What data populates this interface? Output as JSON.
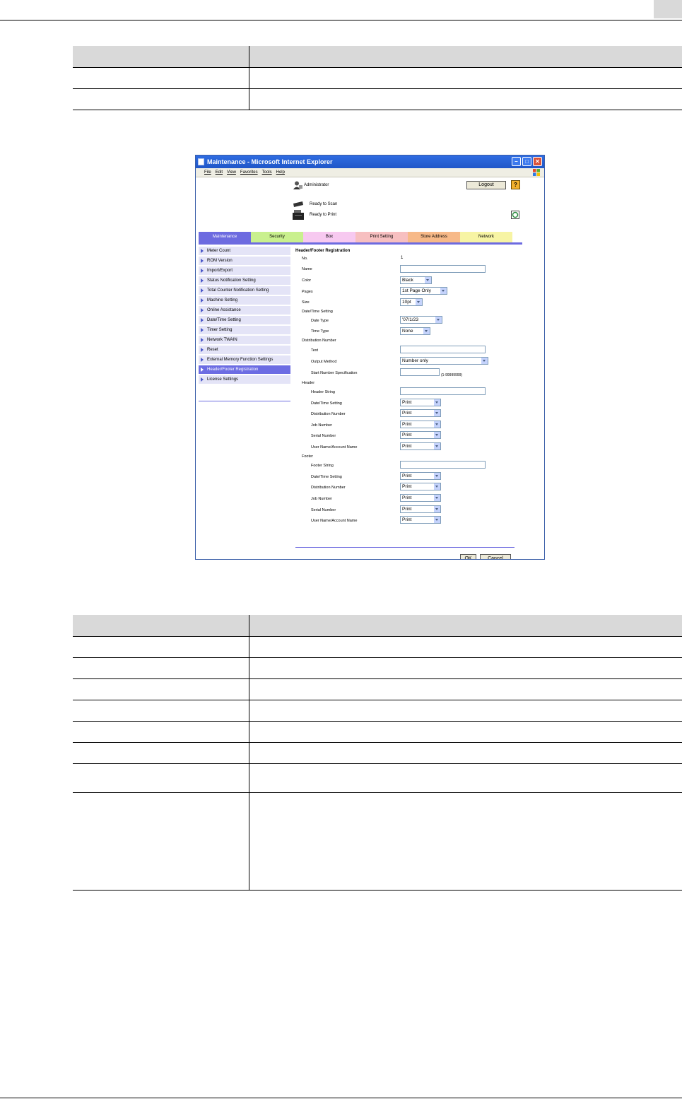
{
  "browser": {
    "title": "Maintenance - Microsoft Internet Explorer",
    "menu": [
      "File",
      "Edit",
      "View",
      "Favorites",
      "Tools",
      "Help"
    ]
  },
  "header": {
    "user": "Administrator",
    "logout_label": "Logout",
    "help_label": "?",
    "scan_status": "Ready to Scan",
    "print_status": "Ready to Print"
  },
  "tabs": [
    {
      "label": "Maintenance",
      "color": "#6d6be0",
      "text_color": "#ffffff"
    },
    {
      "label": "Security",
      "color": "#c9f08e",
      "text_color": "#000000"
    },
    {
      "label": "Box",
      "color": "#f7c9f0",
      "text_color": "#000000"
    },
    {
      "label": "Print Setting",
      "color": "#f7bfc0",
      "text_color": "#000000"
    },
    {
      "label": "Store Address",
      "color": "#f7b988",
      "text_color": "#000000"
    },
    {
      "label": "Network",
      "color": "#f7f4a4",
      "text_color": "#000000"
    }
  ],
  "sidebar": {
    "items": [
      "Meter Count",
      "ROM Version",
      "Import/Export",
      "Status Notification Setting",
      "Total Counter Notification Setting",
      "Machine Setting",
      "Online Assistance",
      "Date/Time Setting",
      "Timer Setting",
      "Network TWAIN",
      "Reset",
      "External Memory Function Settings",
      "Header/Footer Registration",
      "License Settings"
    ],
    "active_index": 12
  },
  "form": {
    "title": "Header/Footer Registration",
    "no_label": "No.",
    "no_value": "1",
    "name_label": "Name",
    "color_label": "Color",
    "color_value": "Black",
    "pages_label": "Pages",
    "pages_value": "1st Page Only",
    "size_label": "Size",
    "size_value": "10pt",
    "datetime_section": "Date/Time Setting",
    "date_type_label": "Date Type",
    "date_type_value": "'07/1/23",
    "time_type_label": "Time Type",
    "time_type_value": "None",
    "distribution_section": "Distribution Number",
    "text_label": "Text",
    "output_method_label": "Output Method",
    "output_method_value": "Number only",
    "start_number_label": "Start Number Specification",
    "start_number_range": "(1-99999999)",
    "header_section": "Header",
    "header_string_label": "Header String",
    "footer_section": "Footer",
    "footer_string_label": "Footer String",
    "sub_labels": [
      "Date/Time Setting",
      "Distribution Number",
      "Job Number",
      "Serial Number",
      "User Name/Account Name"
    ],
    "print_value": "Print",
    "ok_label": "OK",
    "cancel_label": "Cancel"
  }
}
